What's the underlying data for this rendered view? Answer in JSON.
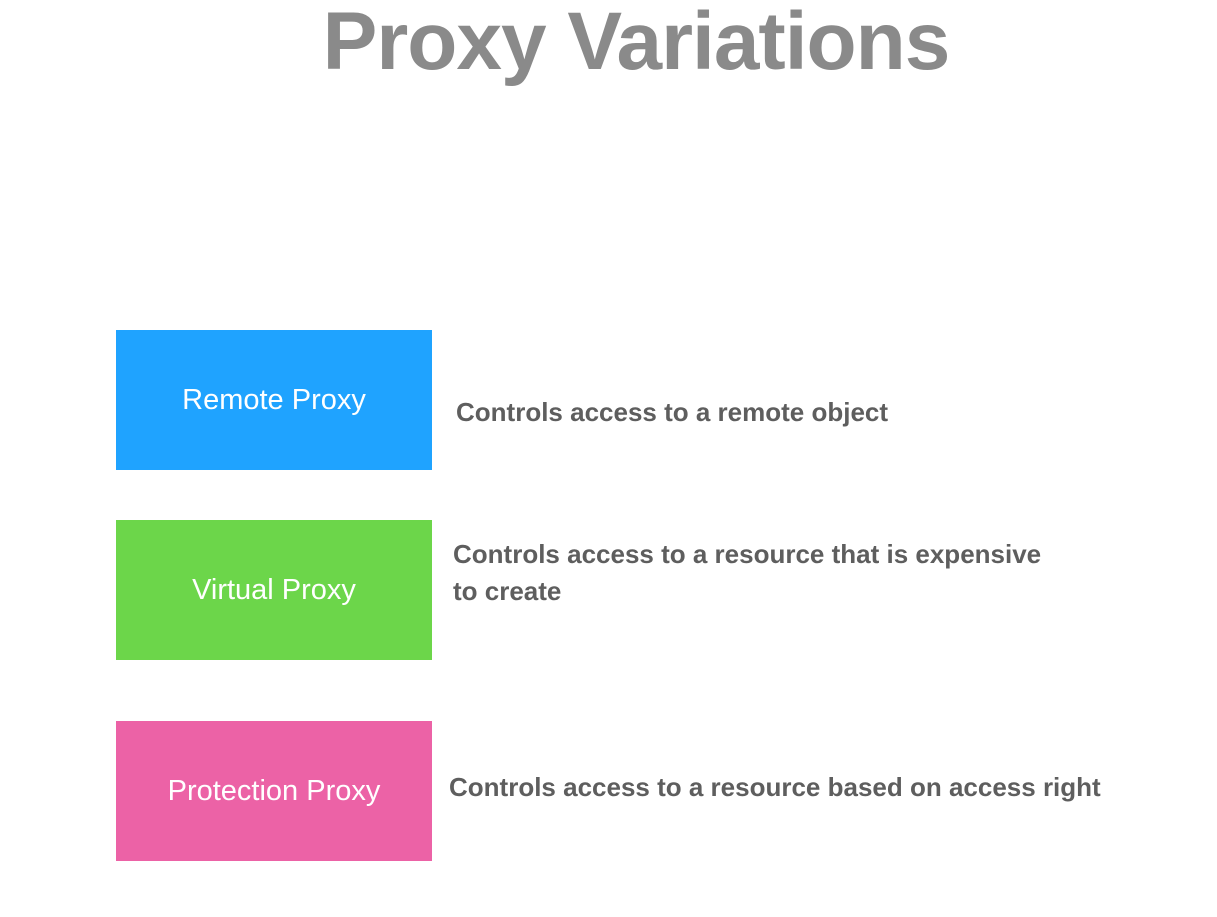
{
  "title": "Proxy Variations",
  "colors": {
    "remote": "#1fa3ff",
    "virtual": "#6cd64a",
    "protection": "#ec62a6",
    "title_text": "#8a8a8a",
    "desc_text": "#5e5e5e"
  },
  "proxies": [
    {
      "label": "Remote Proxy",
      "description_lines": [
        "Controls access to a remote object"
      ]
    },
    {
      "label": "Virtual Proxy",
      "description_lines": [
        "Controls access to a resource that is expensive",
        "to create"
      ]
    },
    {
      "label": "Protection Proxy",
      "description_lines": [
        "Controls access to a resource based on access right"
      ]
    }
  ]
}
